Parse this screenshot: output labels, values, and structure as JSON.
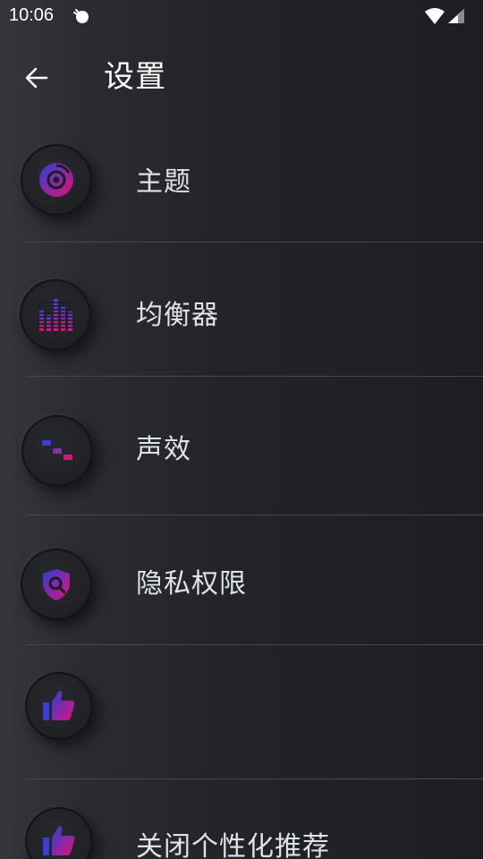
{
  "status_bar": {
    "time": "10:06",
    "notification_icon": "android-debug-icon",
    "wifi_icon": "wifi-icon",
    "signal_icon": "signal-icon"
  },
  "app_bar": {
    "back_icon": "arrow-left-icon",
    "title": "设置"
  },
  "colors": {
    "background": "#1f2024",
    "icon_gradient_start": "#2b3fd6",
    "icon_gradient_end": "#e0127a",
    "label_text": "#dfe2ea",
    "divider": "#46484e"
  },
  "items": [
    {
      "label": "主题",
      "icon": "theme-disc-icon"
    },
    {
      "label": "均衡器",
      "icon": "equalizer-bars-icon"
    },
    {
      "label": "声效",
      "icon": "sliders-icon"
    },
    {
      "label": "隐私权限",
      "icon": "privacy-shield-icon"
    },
    {
      "label": "",
      "icon": "thumbs-up-icon"
    },
    {
      "label": "关闭个性化推荐",
      "icon": "thumbs-up-icon"
    }
  ]
}
